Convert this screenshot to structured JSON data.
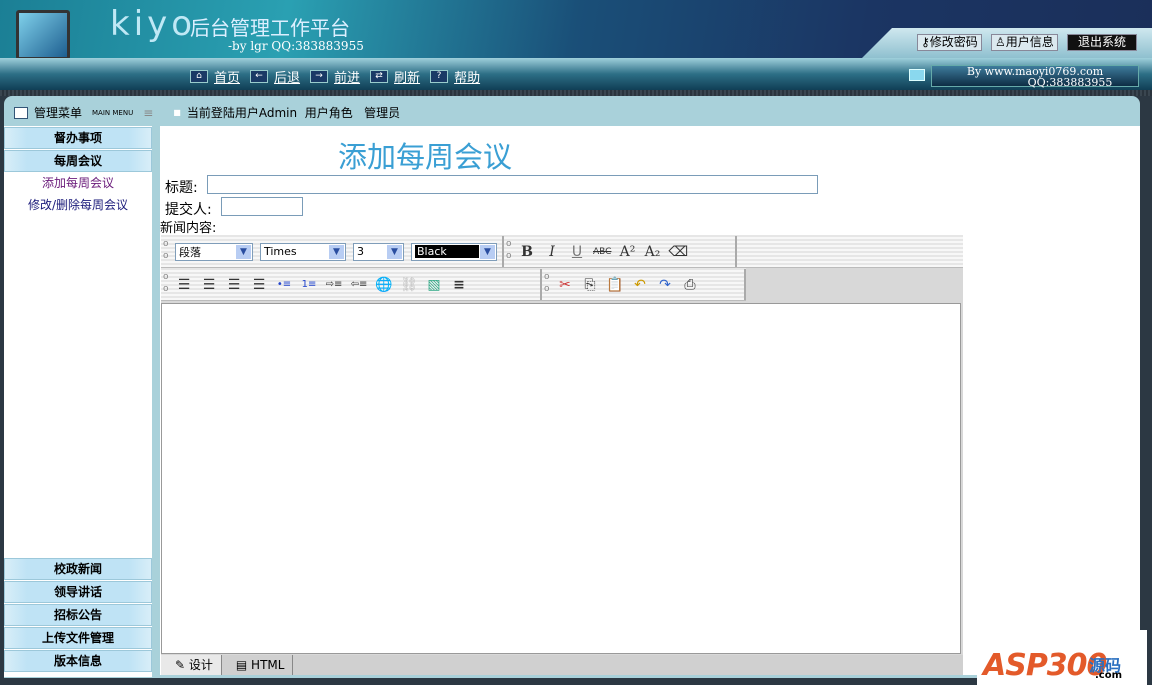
{
  "header": {
    "logo": "kiyo",
    "logo_accent": "o",
    "subtitle": "后台管理工作平台",
    "byline": "-by lgr QQ:383883955",
    "buttons": [
      {
        "label": "修改密码",
        "icon": "key-icon"
      },
      {
        "label": "用户信息",
        "icon": "user-icon"
      },
      {
        "label": "退出系统"
      }
    ]
  },
  "nav": {
    "items": [
      {
        "label": "首页",
        "icon": "home-icon"
      },
      {
        "label": "后退",
        "icon": "back-icon"
      },
      {
        "label": "前进",
        "icon": "forward-icon"
      },
      {
        "label": "刷新",
        "icon": "refresh-icon"
      },
      {
        "label": "帮助",
        "icon": "help-icon"
      }
    ],
    "info_line1": "By www.maoyi0769.com",
    "info_line2": "QQ:383883955"
  },
  "panel": {
    "menu_title": "管理菜单",
    "menu_sub": "MAIN MENU",
    "current_user": "当前登陆用户Admin  用户角色   管理员"
  },
  "sidebar": {
    "top": [
      {
        "label": "督办事项"
      },
      {
        "label": "每周会议"
      }
    ],
    "sub": [
      {
        "label": "添加每周会议",
        "color": "#6a1a7a"
      },
      {
        "label": "修改/删除每周会议",
        "color": "#1a1a7a"
      }
    ],
    "bottom": [
      {
        "label": "校政新闻"
      },
      {
        "label": "领导讲话"
      },
      {
        "label": "招标公告"
      },
      {
        "label": "上传文件管理"
      },
      {
        "label": "版本信息"
      }
    ]
  },
  "form": {
    "title": "添加每周会议",
    "title_label": "标题:",
    "title_value": "",
    "submitter_label": "提交人:",
    "submitter_value": "",
    "content_label": "新闻内容:"
  },
  "editor": {
    "paragraph": "段落",
    "font": "Times",
    "size": "3",
    "color": "Black",
    "format_buttons": [
      "B",
      "I",
      "U",
      "ABC",
      "A²",
      "A₂",
      "⌫"
    ],
    "tabs": [
      {
        "label": "设计"
      },
      {
        "label": "HTML"
      }
    ]
  },
  "watermark": {
    "text": "ASP300",
    "cn": "源码",
    "domain": ".com"
  }
}
